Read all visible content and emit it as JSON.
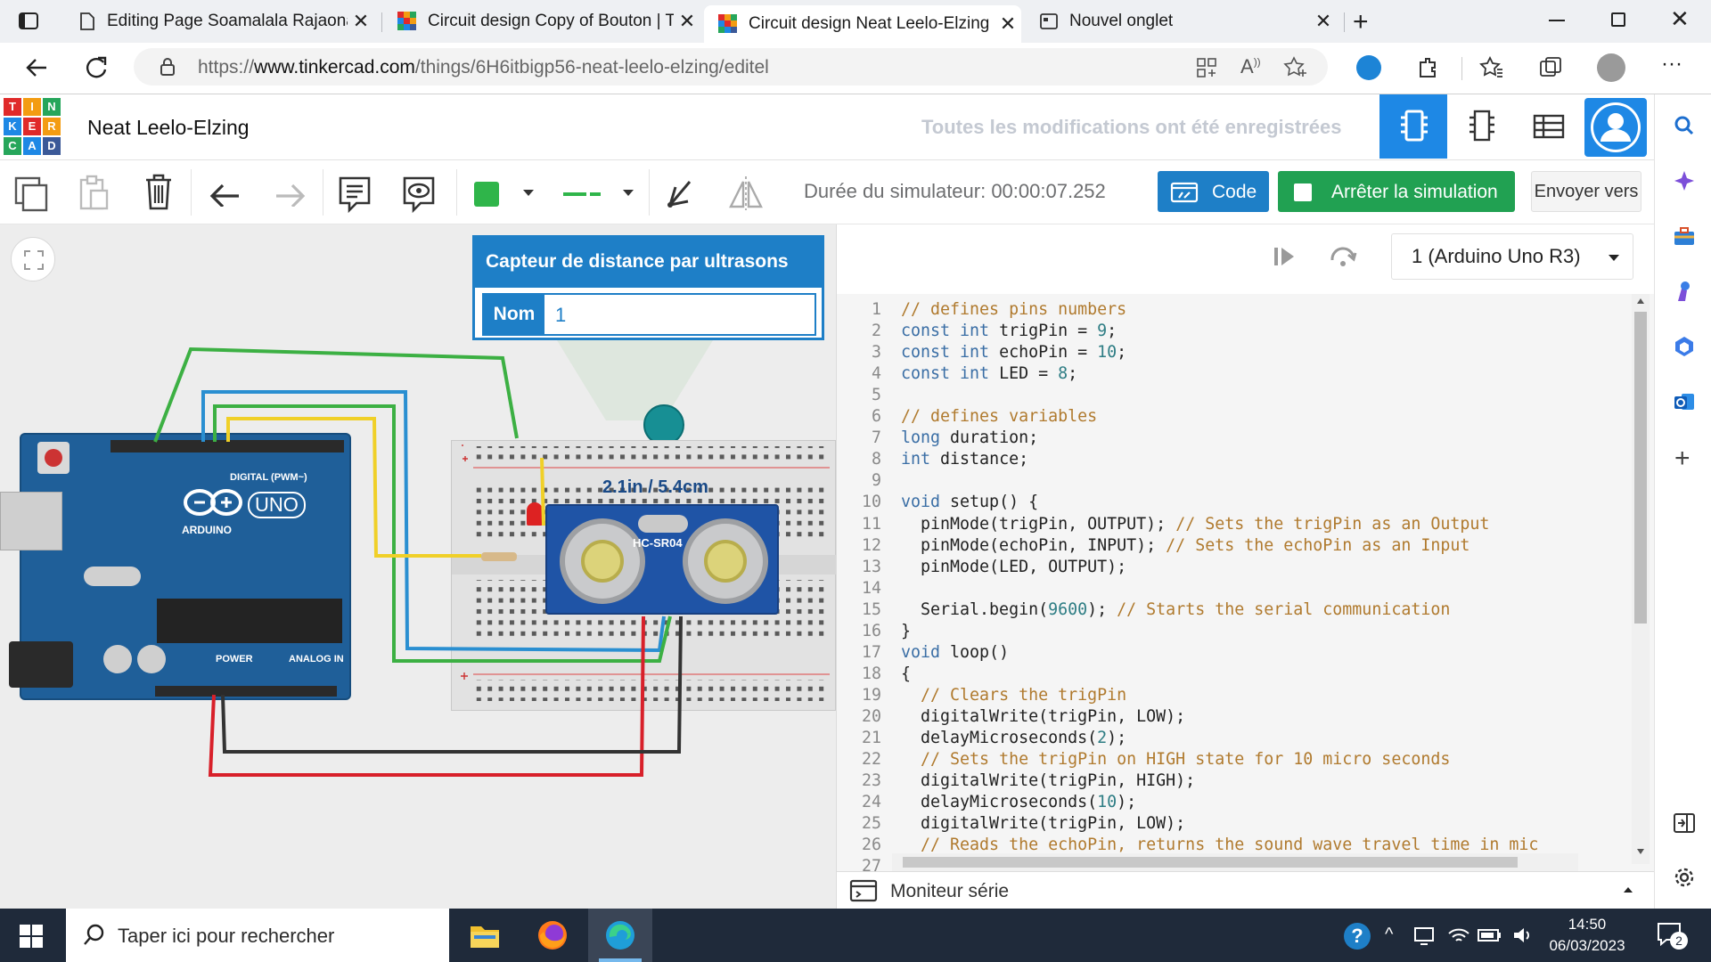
{
  "browser": {
    "tabs": [
      {
        "title": "Editing Page Soamalala Rajaonar",
        "active": false
      },
      {
        "title": "Circuit design Copy of Bouton | T",
        "active": false
      },
      {
        "title": "Circuit design Neat Leelo-Elzing |",
        "active": true
      },
      {
        "title": "Nouvel onglet",
        "active": false
      }
    ],
    "url_prefix": "https://",
    "url_host": "www.tinkercad.com",
    "url_path": "/things/6H6itbigp56-neat-leelo-elzing/editel"
  },
  "app": {
    "logo_letters": [
      "T",
      "I",
      "N",
      "K",
      "E",
      "R",
      "C",
      "A",
      "D"
    ],
    "logo_colors": [
      "#e02a2a",
      "#f39c12",
      "#26a65b",
      "#1e88e5",
      "#e02a2a",
      "#f39c12",
      "#26a65b",
      "#1e88e5",
      "#3b5998"
    ],
    "project_title": "Neat Leelo-Elzing",
    "save_status": "Toutes les modifications ont été enregistrées",
    "accent_color": "#1e7fc7",
    "sim_green": "#21a152"
  },
  "toolbar": {
    "sim_time": "Durée du simulateur: 00:00:07.252",
    "code_label": "Code",
    "stop_label": "Arrêter la simulation",
    "send_label": "Envoyer vers",
    "fill_color": "#2fb54a"
  },
  "inspector": {
    "title": "Capteur de distance par ultrasons",
    "name_label": "Nom",
    "name_value": "1"
  },
  "circuit": {
    "distance_label": "2.1in / 5.4cm",
    "sensor_label": "HC-SR04",
    "board_brand": "ARDUINO",
    "board_model": "UNO",
    "digital_label": "DIGITAL (PWM~)",
    "power_label": "POWER",
    "analog_label": "ANALOG IN"
  },
  "code_panel": {
    "device": "1 (Arduino Uno R3)",
    "serial_monitor_label": "Moniteur série",
    "lines": [
      "// defines pins numbers",
      "const int trigPin = 9;",
      "const int echoPin = 10;",
      "const int LED = 8;",
      "",
      "// defines variables",
      "long duration;",
      "int distance;",
      "",
      "void setup() {",
      "  pinMode(trigPin, OUTPUT); // Sets the trigPin as an Output",
      "  pinMode(echoPin, INPUT); // Sets the echoPin as an Input",
      "  pinMode(LED, OUTPUT);",
      "",
      "  Serial.begin(9600); // Starts the serial communication",
      "}",
      "void loop()",
      "{",
      "  // Clears the trigPin",
      "  digitalWrite(trigPin, LOW);",
      "  delayMicroseconds(2);",
      "  // Sets the trigPin on HIGH state for 10 micro seconds",
      "  digitalWrite(trigPin, HIGH);",
      "  delayMicroseconds(10);",
      "  digitalWrite(trigPin, LOW);",
      "  // Reads the echoPin, returns the sound wave travel time in mic",
      ""
    ]
  },
  "taskbar": {
    "search_placeholder": "Taper ici pour rechercher",
    "time": "14:50",
    "date": "06/03/2023",
    "notification_count": "2"
  }
}
